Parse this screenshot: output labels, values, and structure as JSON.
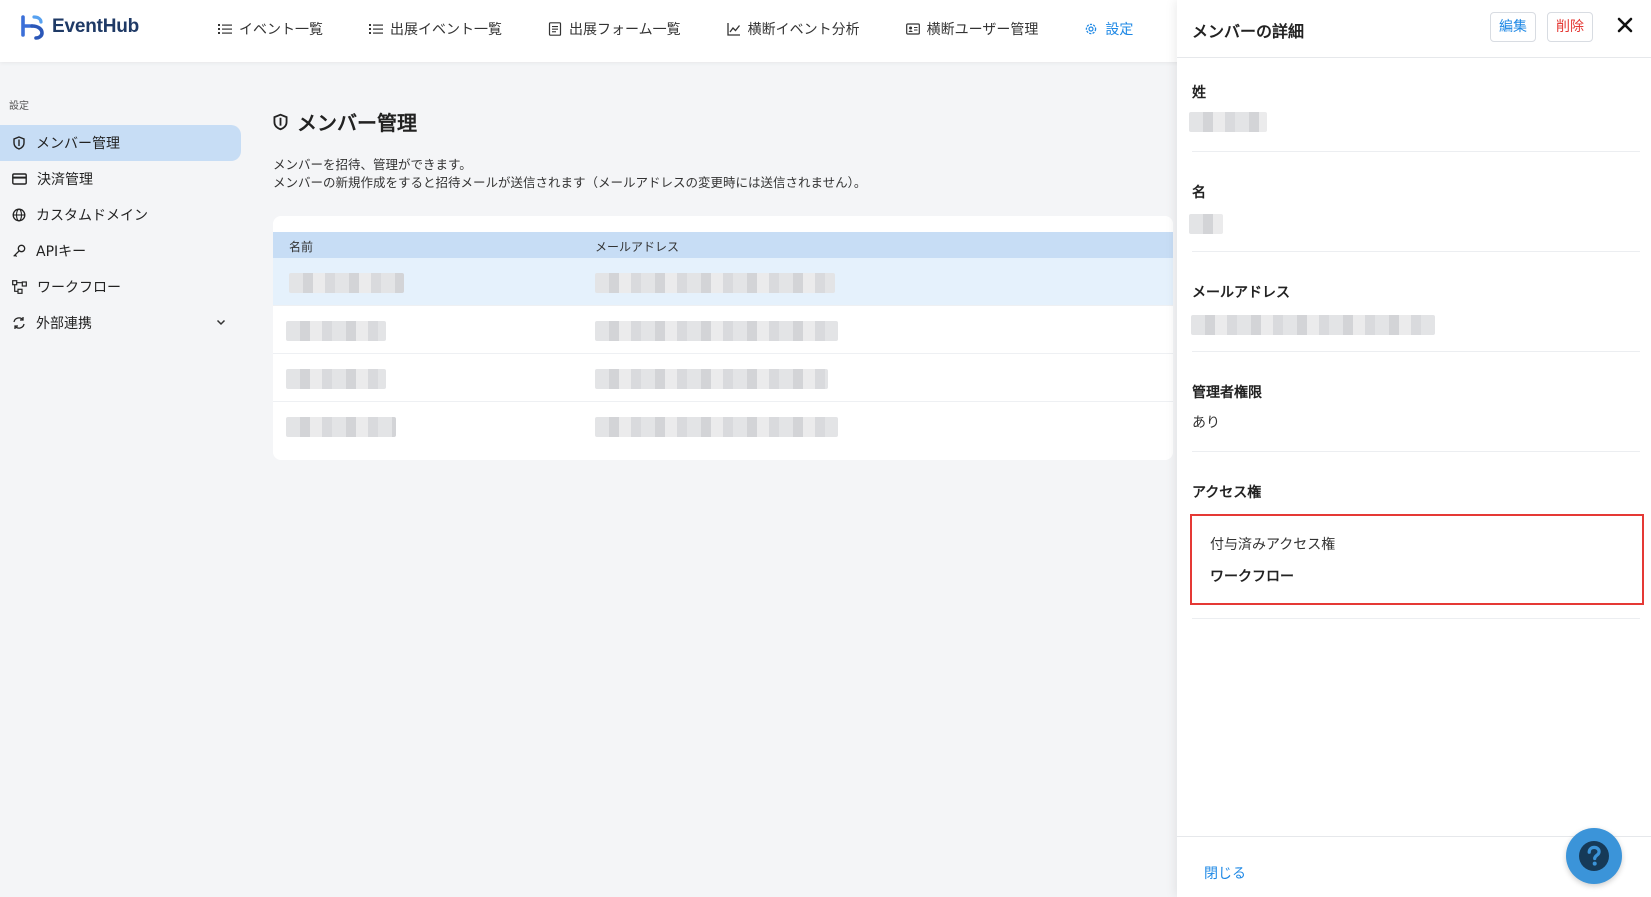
{
  "app": {
    "logo_text": "EventHub"
  },
  "nav": {
    "items": [
      {
        "label": "イベント一覧",
        "icon": "list-icon",
        "active": false
      },
      {
        "label": "出展イベント一覧",
        "icon": "list-icon",
        "active": false
      },
      {
        "label": "出展フォーム一覧",
        "icon": "form-icon",
        "active": false
      },
      {
        "label": "横断イベント分析",
        "icon": "chart-icon",
        "active": false
      },
      {
        "label": "横断ユーザー管理",
        "icon": "id-card-icon",
        "active": false
      },
      {
        "label": "設定",
        "icon": "gear-icon",
        "active": true
      }
    ]
  },
  "sidebar": {
    "section_label": "設定",
    "items": [
      {
        "label": "メンバー管理",
        "icon": "shield-icon",
        "active": true
      },
      {
        "label": "決済管理",
        "icon": "credit-card-icon",
        "active": false
      },
      {
        "label": "カスタムドメイン",
        "icon": "globe-icon",
        "active": false
      },
      {
        "label": "APIキー",
        "icon": "key-icon",
        "active": false
      },
      {
        "label": "ワークフロー",
        "icon": "workflow-icon",
        "active": false
      },
      {
        "label": "外部連携",
        "icon": "sync-icon",
        "active": false,
        "expandable": true
      }
    ]
  },
  "main": {
    "title": "メンバー管理",
    "description_line1": "メンバーを招待、管理ができます。",
    "description_line2": "メンバーの新規作成をすると招待メールが送信されます（メールアドレスの変更時には送信されません）。",
    "table": {
      "columns": [
        "名前",
        "メールアドレス"
      ],
      "row_count": 4
    }
  },
  "panel": {
    "title": "メンバーの詳細",
    "edit_label": "編集",
    "delete_label": "削除",
    "fields": {
      "last_name_label": "姓",
      "first_name_label": "名",
      "email_label": "メールアドレス",
      "admin_label": "管理者権限",
      "admin_value": "あり",
      "access_label": "アクセス権",
      "granted_access_label": "付与済みアクセス権",
      "granted_access_value": "ワークフロー"
    },
    "close_label": "閉じる"
  },
  "colors": {
    "accent": "#1e88e5",
    "danger": "#e53935",
    "active_bg": "#c7ddf5",
    "logo": "#1f3a66"
  }
}
